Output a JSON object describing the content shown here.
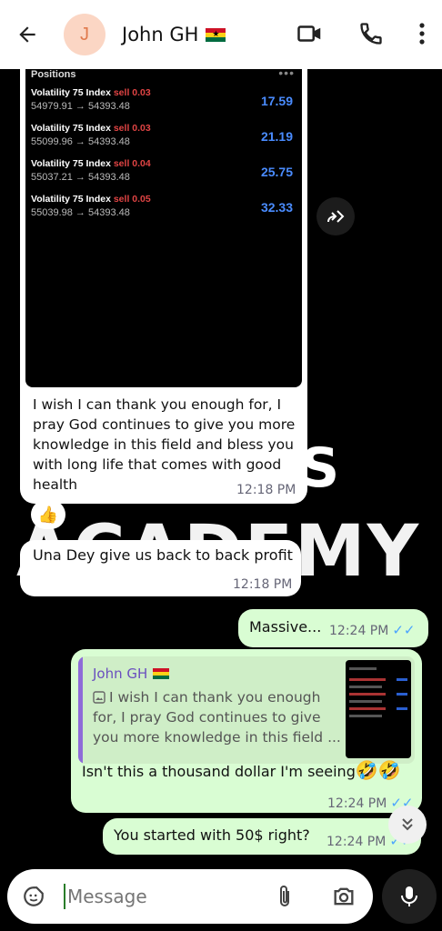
{
  "header": {
    "avatar_initial": "J",
    "contact_name": "John GH",
    "flag_colors": [
      "#ce1126",
      "#fcd116",
      "#006b3f"
    ]
  },
  "watermark": {
    "line1": "S",
    "line2": "ACADEMY"
  },
  "positions_screenshot": {
    "title": "Positions",
    "dots": "•••",
    "rows": [
      {
        "symbol": "Volatility 75 Index",
        "side": "sell 0.03",
        "prices": "54979.91 → 54393.48",
        "profit": "17.59"
      },
      {
        "symbol": "Volatility 75 Index",
        "side": "sell 0.03",
        "prices": "55099.96 → 54393.48",
        "profit": "21.19"
      },
      {
        "symbol": "Volatility 75 Index",
        "side": "sell 0.04",
        "prices": "55037.21 → 54393.48",
        "profit": "25.75"
      },
      {
        "symbol": "Volatility 75 Index",
        "side": "sell 0.05",
        "prices": "55039.98 → 54393.48",
        "profit": "32.33"
      }
    ]
  },
  "messages": {
    "m1": {
      "lines": [
        "I wish I can thank you enough for, I",
        "pray God continues to give you more",
        "knowledge in this field and bless you",
        "with long life that comes with good",
        "health"
      ],
      "time": "12:18 PM",
      "reaction": "👍"
    },
    "m2": {
      "text": "Una Dey give us back to back profit",
      "time": "12:18 PM"
    },
    "m3": {
      "text": "Massive...",
      "time": "12:24 PM"
    },
    "m4": {
      "quote_name": "John GH",
      "quote_lines": [
        "I wish I can thank you enough",
        "for, I pray God continues to give",
        "you more knowledge in this field ..."
      ],
      "text": "Isn't this a thousand dollar I'm seeing",
      "emoji": "🤣🤣",
      "time": "12:24 PM"
    },
    "m5": {
      "text": "You started with 50$ right?",
      "time": "12:24 PM"
    }
  },
  "composer": {
    "placeholder": "Message"
  }
}
